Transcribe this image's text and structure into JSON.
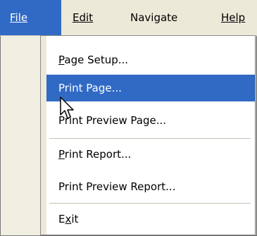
{
  "menubar": {
    "items": [
      {
        "label": "File",
        "accel_index": 0,
        "active": true
      },
      {
        "label": "Edit",
        "accel_index": 0
      },
      {
        "label": "Navigate",
        "accel_index": -1
      },
      {
        "label": "Help",
        "accel_index": 0
      }
    ]
  },
  "file_menu": {
    "page_setup": {
      "accel": "P",
      "rest": "age Setup..."
    },
    "print_page": {
      "label": "Print Page..."
    },
    "print_preview_page": {
      "label": "Print Preview Page..."
    },
    "print_report": {
      "accel": "P",
      "rest": "rint Report..."
    },
    "print_preview_report": {
      "label": "Print Preview Report..."
    },
    "exit": {
      "pre": "E",
      "accel": "x",
      "post": "it"
    }
  },
  "colors": {
    "highlight": "#316ac5",
    "menu_bg": "#ece9d8"
  },
  "pointer": "arrow-cursor-icon"
}
